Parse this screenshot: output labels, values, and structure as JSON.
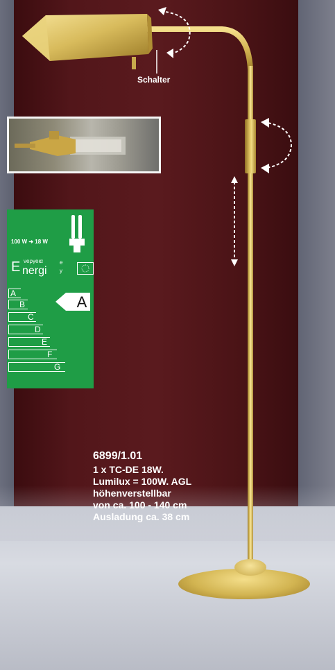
{
  "callout": {
    "switch_label": "Schalter"
  },
  "energy_label": {
    "wattage": "100 W ➜ 18 W",
    "title_big": "E",
    "title_word": "nergi",
    "title_suffix": "e",
    "title_small": "νeργeια",
    "title_y": "y",
    "grades": [
      "A",
      "B",
      "C",
      "D",
      "E",
      "F",
      "G"
    ],
    "rating": "A",
    "colors": {
      "background": "#1f9d46",
      "text": "#ffffff"
    }
  },
  "product": {
    "code": "6899/1.01",
    "lines": [
      "1 x TC-DE 18W.",
      "Lumilux = 100W. AGL",
      "höhenverstellbar",
      "von ca. 100 - 140 cm",
      "Ausladung ca. 38 cm"
    ]
  },
  "colors": {
    "backdrop": "#52161a",
    "brass": "#d8b95a",
    "floor": "#cfd2da"
  }
}
